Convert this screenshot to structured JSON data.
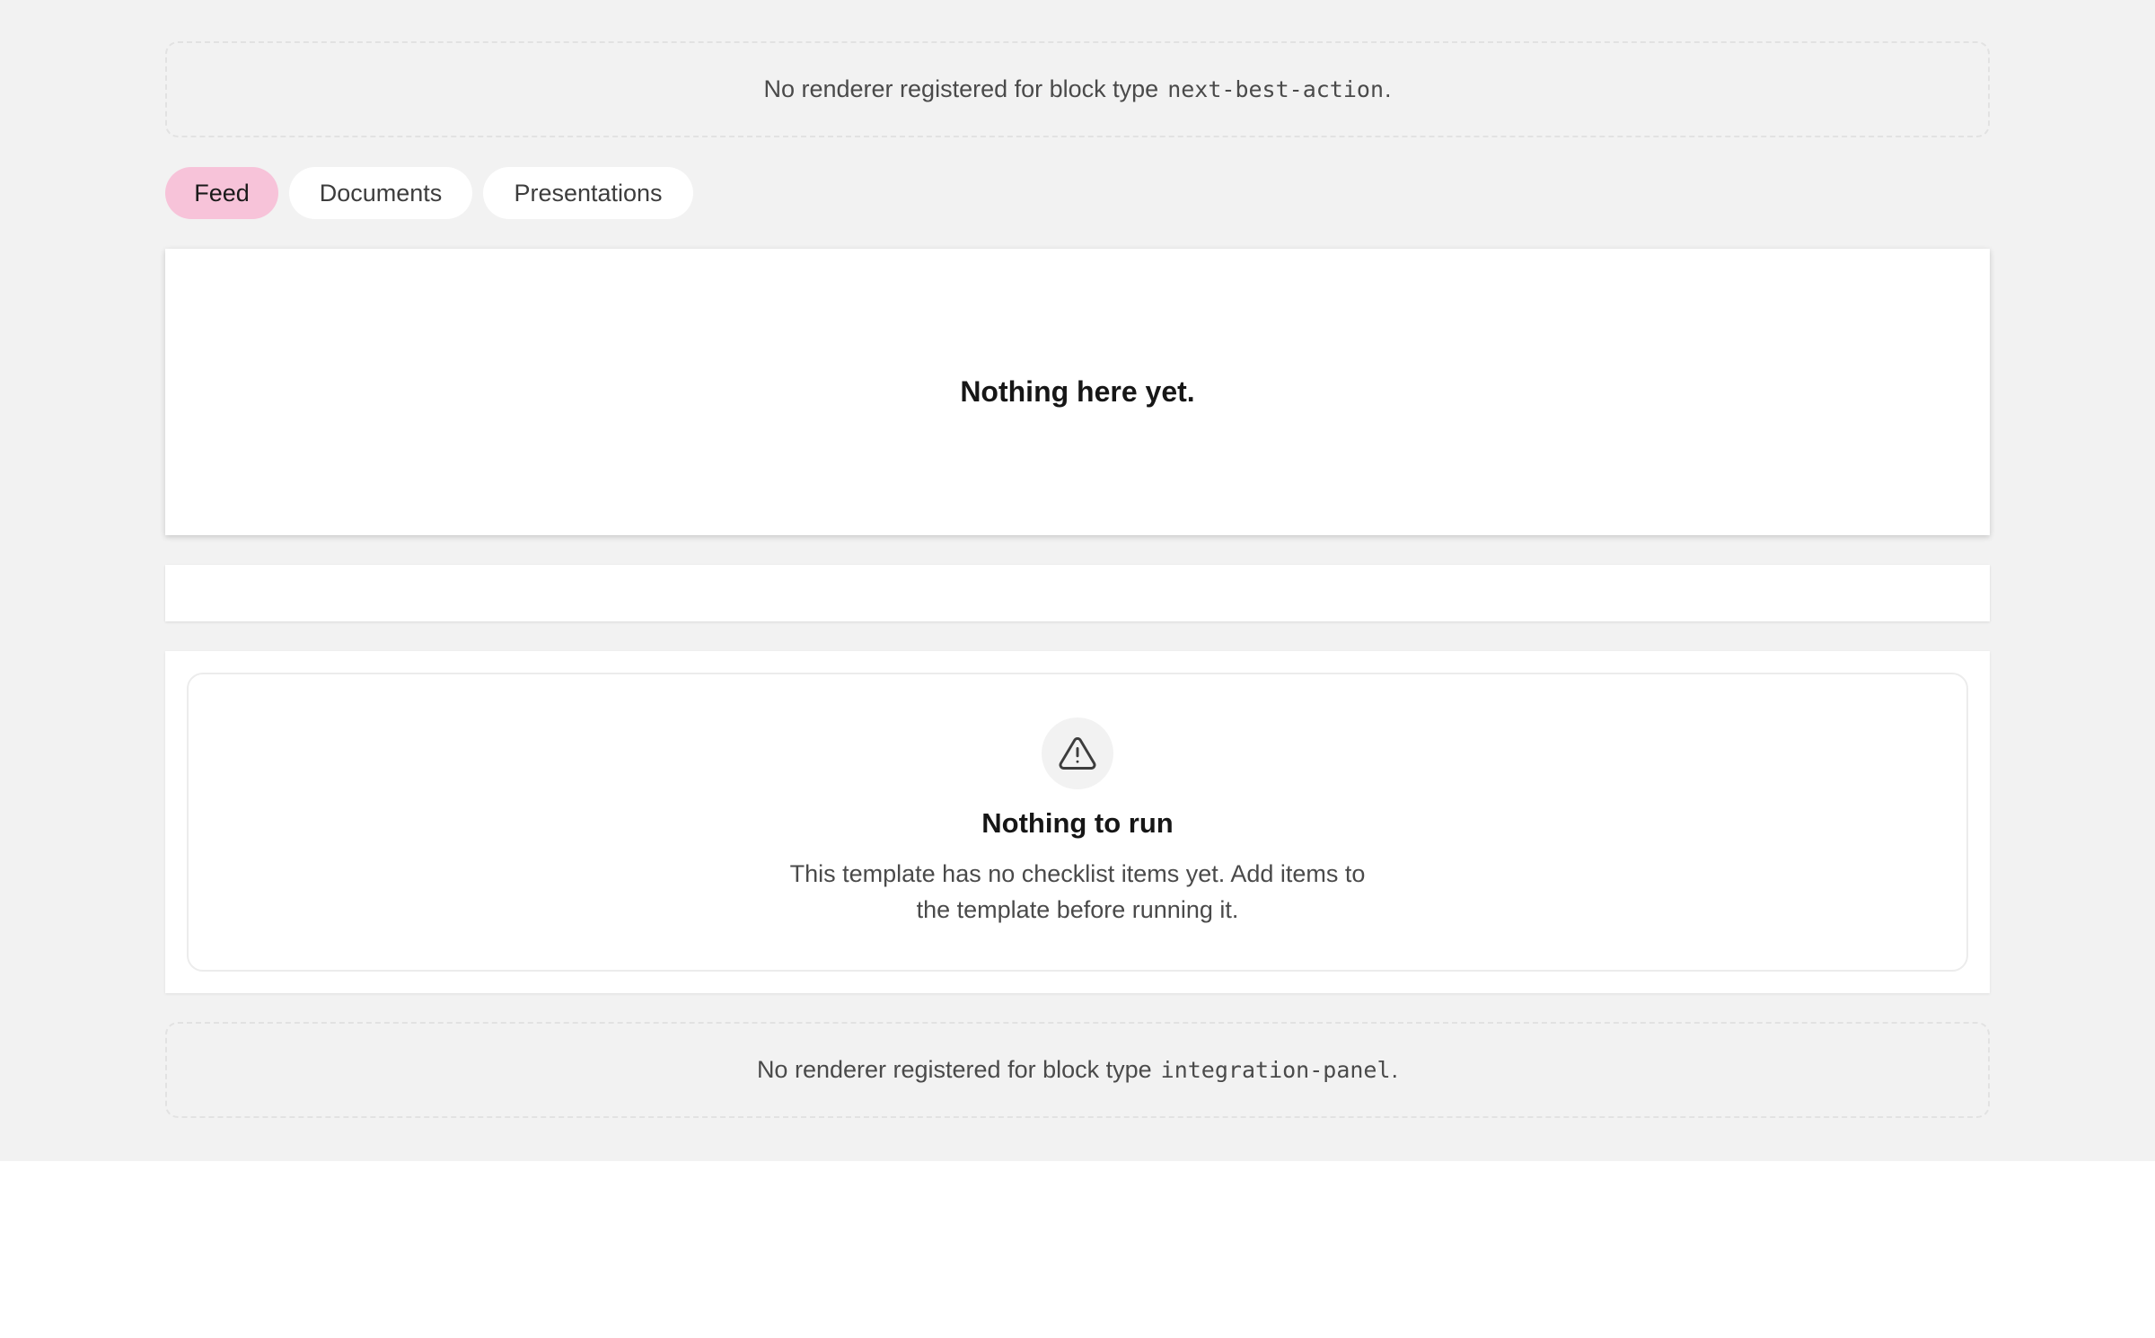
{
  "placeholders": {
    "top": {
      "prefix": "No renderer registered for block type",
      "block_type": "next-best-action",
      "suffix": "."
    },
    "bottom": {
      "prefix": "No renderer registered for block type",
      "block_type": "integration-panel",
      "suffix": "."
    }
  },
  "tabs": [
    {
      "label": "Feed",
      "active": true
    },
    {
      "label": "Documents",
      "active": false
    },
    {
      "label": "Presentations",
      "active": false
    }
  ],
  "feed": {
    "empty_message": "Nothing here yet."
  },
  "run": {
    "icon": "warning-triangle-icon",
    "title": "Nothing to run",
    "description": "This template has no checklist items yet. Add items to the template before running it."
  },
  "colors": {
    "page_background": "#f2f2f2",
    "active_tab": "#f7c3d9",
    "card": "#ffffff"
  }
}
